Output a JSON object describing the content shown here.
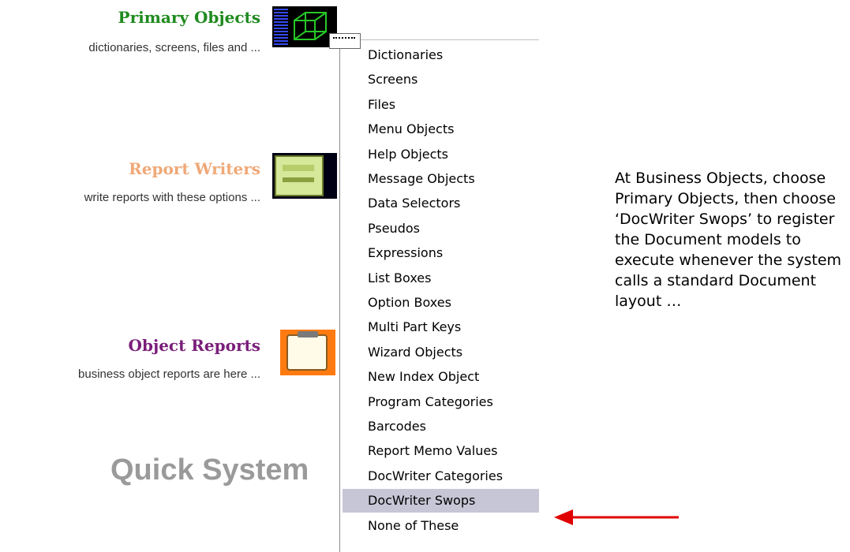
{
  "sections": [
    {
      "title": "Primary Objects",
      "description": "dictionaries, screens, files and ...",
      "title_color": "#1f8a1f"
    },
    {
      "title": "Report Writers",
      "description": "write reports with these options ...",
      "title_color": "#f0a878"
    },
    {
      "title": "Object Reports",
      "description": "business object reports are here ...",
      "title_color": "#7a1e7a"
    }
  ],
  "icons": {
    "primary": "3d-cube-icon",
    "report": "report-screen-icon",
    "object_reports": "clipboard-icon"
  },
  "footer_heading": "Quick System",
  "menu": {
    "items": [
      "Dictionaries",
      "Screens",
      "Files",
      "Menu Objects",
      "Help Objects",
      "Message Objects",
      "Data Selectors",
      "Pseudos",
      "Expressions",
      "List Boxes",
      "Option Boxes",
      "Multi Part Keys",
      "Wizard Objects",
      "New Index Object",
      "Program Categories",
      "Barcodes",
      "Report Memo Values",
      "DocWriter Categories",
      "DocWriter Swops",
      "None of These"
    ],
    "selected": "DocWriter Swops",
    "selected_color": "#c6c6d6"
  },
  "note": "At Business Objects, choose Primary Objects, then choose ‘DocWriter Swops’ to register the Document models to execute whenever the system calls a standard Document layout …",
  "arrow_color": "#e00000"
}
